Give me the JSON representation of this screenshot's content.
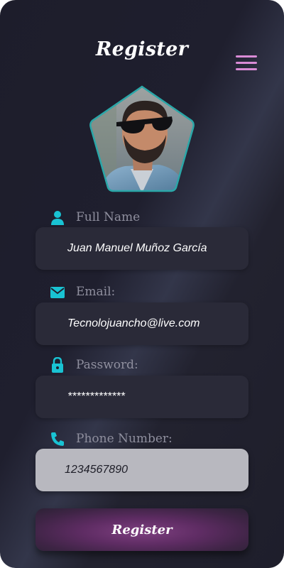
{
  "header": {
    "title": "Register",
    "menu_icon": "hamburger-menu-icon"
  },
  "profile": {
    "avatar_alt": "profile-photo"
  },
  "form": {
    "full_name": {
      "label": "Full Name",
      "value": "Juan Manuel Muñoz García",
      "icon": "person-icon"
    },
    "email": {
      "label": "Email:",
      "value": "Tecnolojuancho@live.com",
      "icon": "envelope-icon"
    },
    "password": {
      "label": "Password:",
      "value": "*************",
      "icon": "lock-icon"
    },
    "phone": {
      "label": "Phone Number:",
      "value": "1234567890",
      "icon": "phone-icon"
    }
  },
  "actions": {
    "register_label": "Register"
  },
  "colors": {
    "accent_icon": "#19c3d3",
    "menu": "#d98bd6",
    "button": "#6a3370",
    "background": "#1f1f2d"
  }
}
